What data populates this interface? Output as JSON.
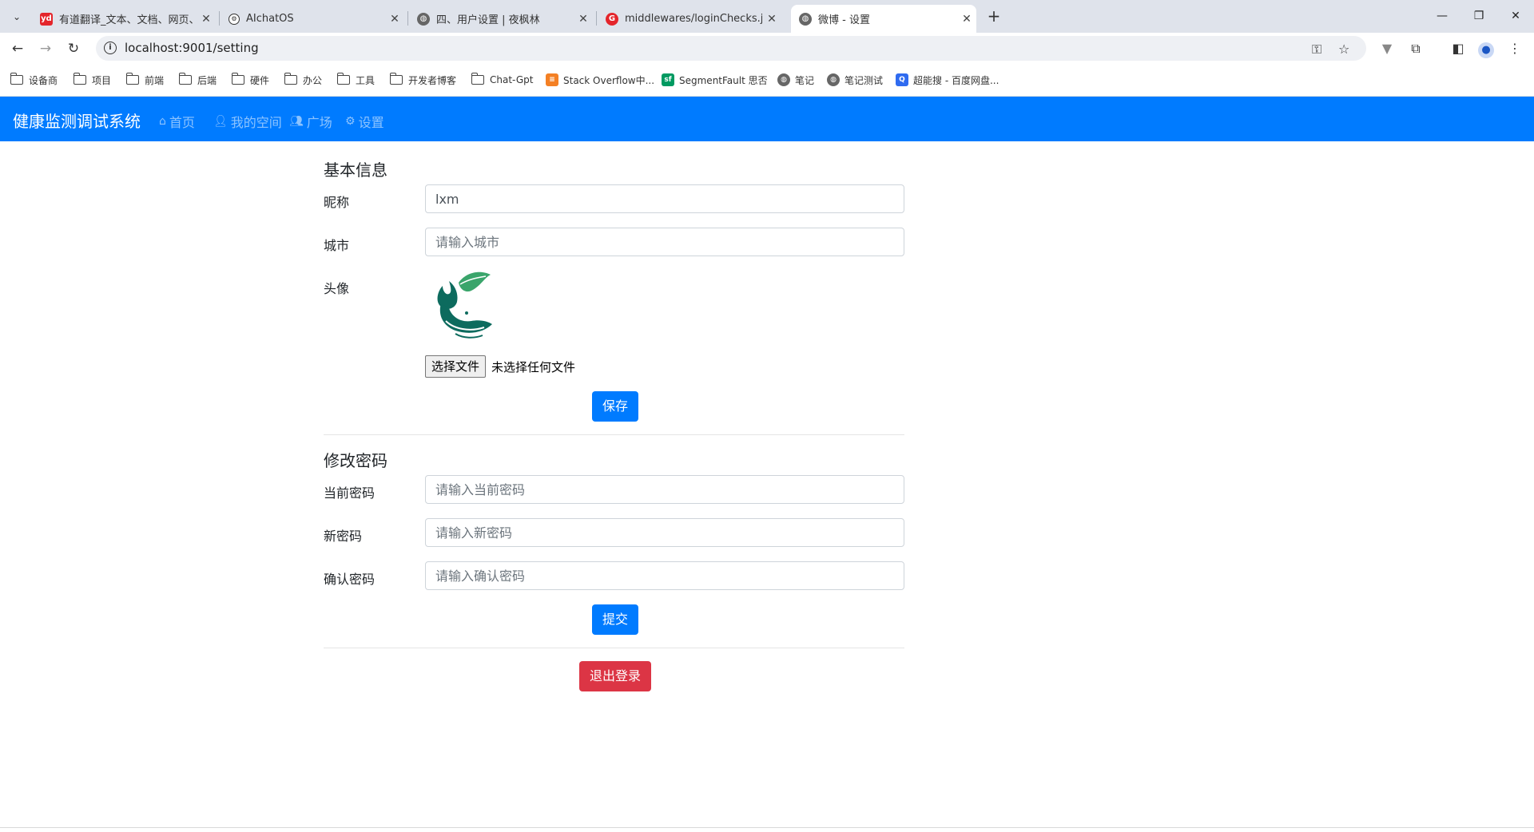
{
  "browser": {
    "tabs": [
      {
        "title": "有道翻译_文本、文档、网页、",
        "favicon": "youdao-icon",
        "color": "#e4252b"
      },
      {
        "title": "AIchatOS",
        "favicon": "openai-icon",
        "color": "#333333"
      },
      {
        "title": "四、用户设置 | 夜枫林",
        "favicon": "globe-icon",
        "color": "#555555"
      },
      {
        "title": "middlewares/loginChecks.js",
        "favicon": "github-icon",
        "color": "#e4252b"
      },
      {
        "title": "微博 - 设置",
        "favicon": "globe-icon",
        "color": "#555555",
        "active": true
      }
    ],
    "url": "localhost:9001/setting",
    "bookmarks": [
      {
        "label": "设备商",
        "type": "folder"
      },
      {
        "label": "项目",
        "type": "folder"
      },
      {
        "label": "前端",
        "type": "folder"
      },
      {
        "label": "后端",
        "type": "folder"
      },
      {
        "label": "硬件",
        "type": "folder"
      },
      {
        "label": "办公",
        "type": "folder"
      },
      {
        "label": "工具",
        "type": "folder"
      },
      {
        "label": "开发者博客",
        "type": "folder"
      },
      {
        "label": "Chat-Gpt",
        "type": "folder"
      },
      {
        "label": "Stack Overflow中...",
        "type": "stackoverflow-icon"
      },
      {
        "label": "SegmentFault 思否",
        "type": "segmentfault-icon"
      },
      {
        "label": "笔记",
        "type": "globe-icon"
      },
      {
        "label": "笔记测试",
        "type": "globe-icon"
      },
      {
        "label": "超能搜 - 百度网盘...",
        "type": "search-icon"
      }
    ]
  },
  "app": {
    "brand": "健康监测调试系统",
    "nav": [
      {
        "label": "首页",
        "icon": "home-icon"
      },
      {
        "label": "我的空间",
        "icon": "user-icon"
      },
      {
        "label": "广场",
        "icon": "users-icon"
      },
      {
        "label": "设置",
        "icon": "gear-icon"
      }
    ]
  },
  "basic_info": {
    "heading": "基本信息",
    "nickname_label": "昵称",
    "nickname_value": "lxm",
    "city_label": "城市",
    "city_placeholder": "请输入城市",
    "avatar_label": "头像",
    "file_button": "选择文件",
    "file_status": "未选择任何文件",
    "save_button": "保存"
  },
  "password": {
    "heading": "修改密码",
    "current_label": "当前密码",
    "current_placeholder": "请输入当前密码",
    "new_label": "新密码",
    "new_placeholder": "请输入新密码",
    "confirm_label": "确认密码",
    "confirm_placeholder": "请输入确认密码",
    "submit_button": "提交"
  },
  "logout_button": "退出登录",
  "colors": {
    "primary": "#007bff",
    "danger": "#dc3545",
    "tabstrip": "#dfe3eb"
  }
}
